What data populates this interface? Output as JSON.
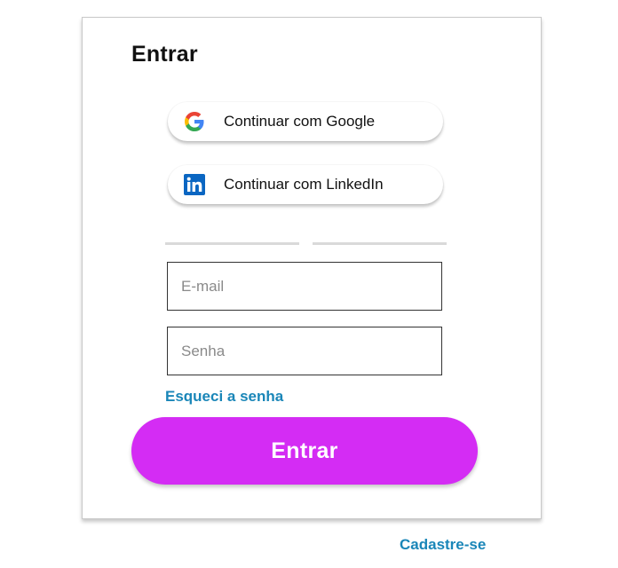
{
  "login": {
    "title": "Entrar",
    "google_label": "Continuar com Google",
    "linkedin_label": "Continuar com LinkedIn",
    "email_placeholder": "E-mail",
    "password_placeholder": "Senha",
    "forgot_label": "Esqueci a senha",
    "submit_label": "Entrar"
  },
  "footer": {
    "signup_label": "Cadastre-se"
  },
  "icons": {
    "google": "google-icon",
    "linkedin": "linkedin-icon"
  },
  "colors": {
    "primary_button": "#d42cf4",
    "link": "#1a86b8",
    "linkedin_blue": "#0a66c2"
  }
}
